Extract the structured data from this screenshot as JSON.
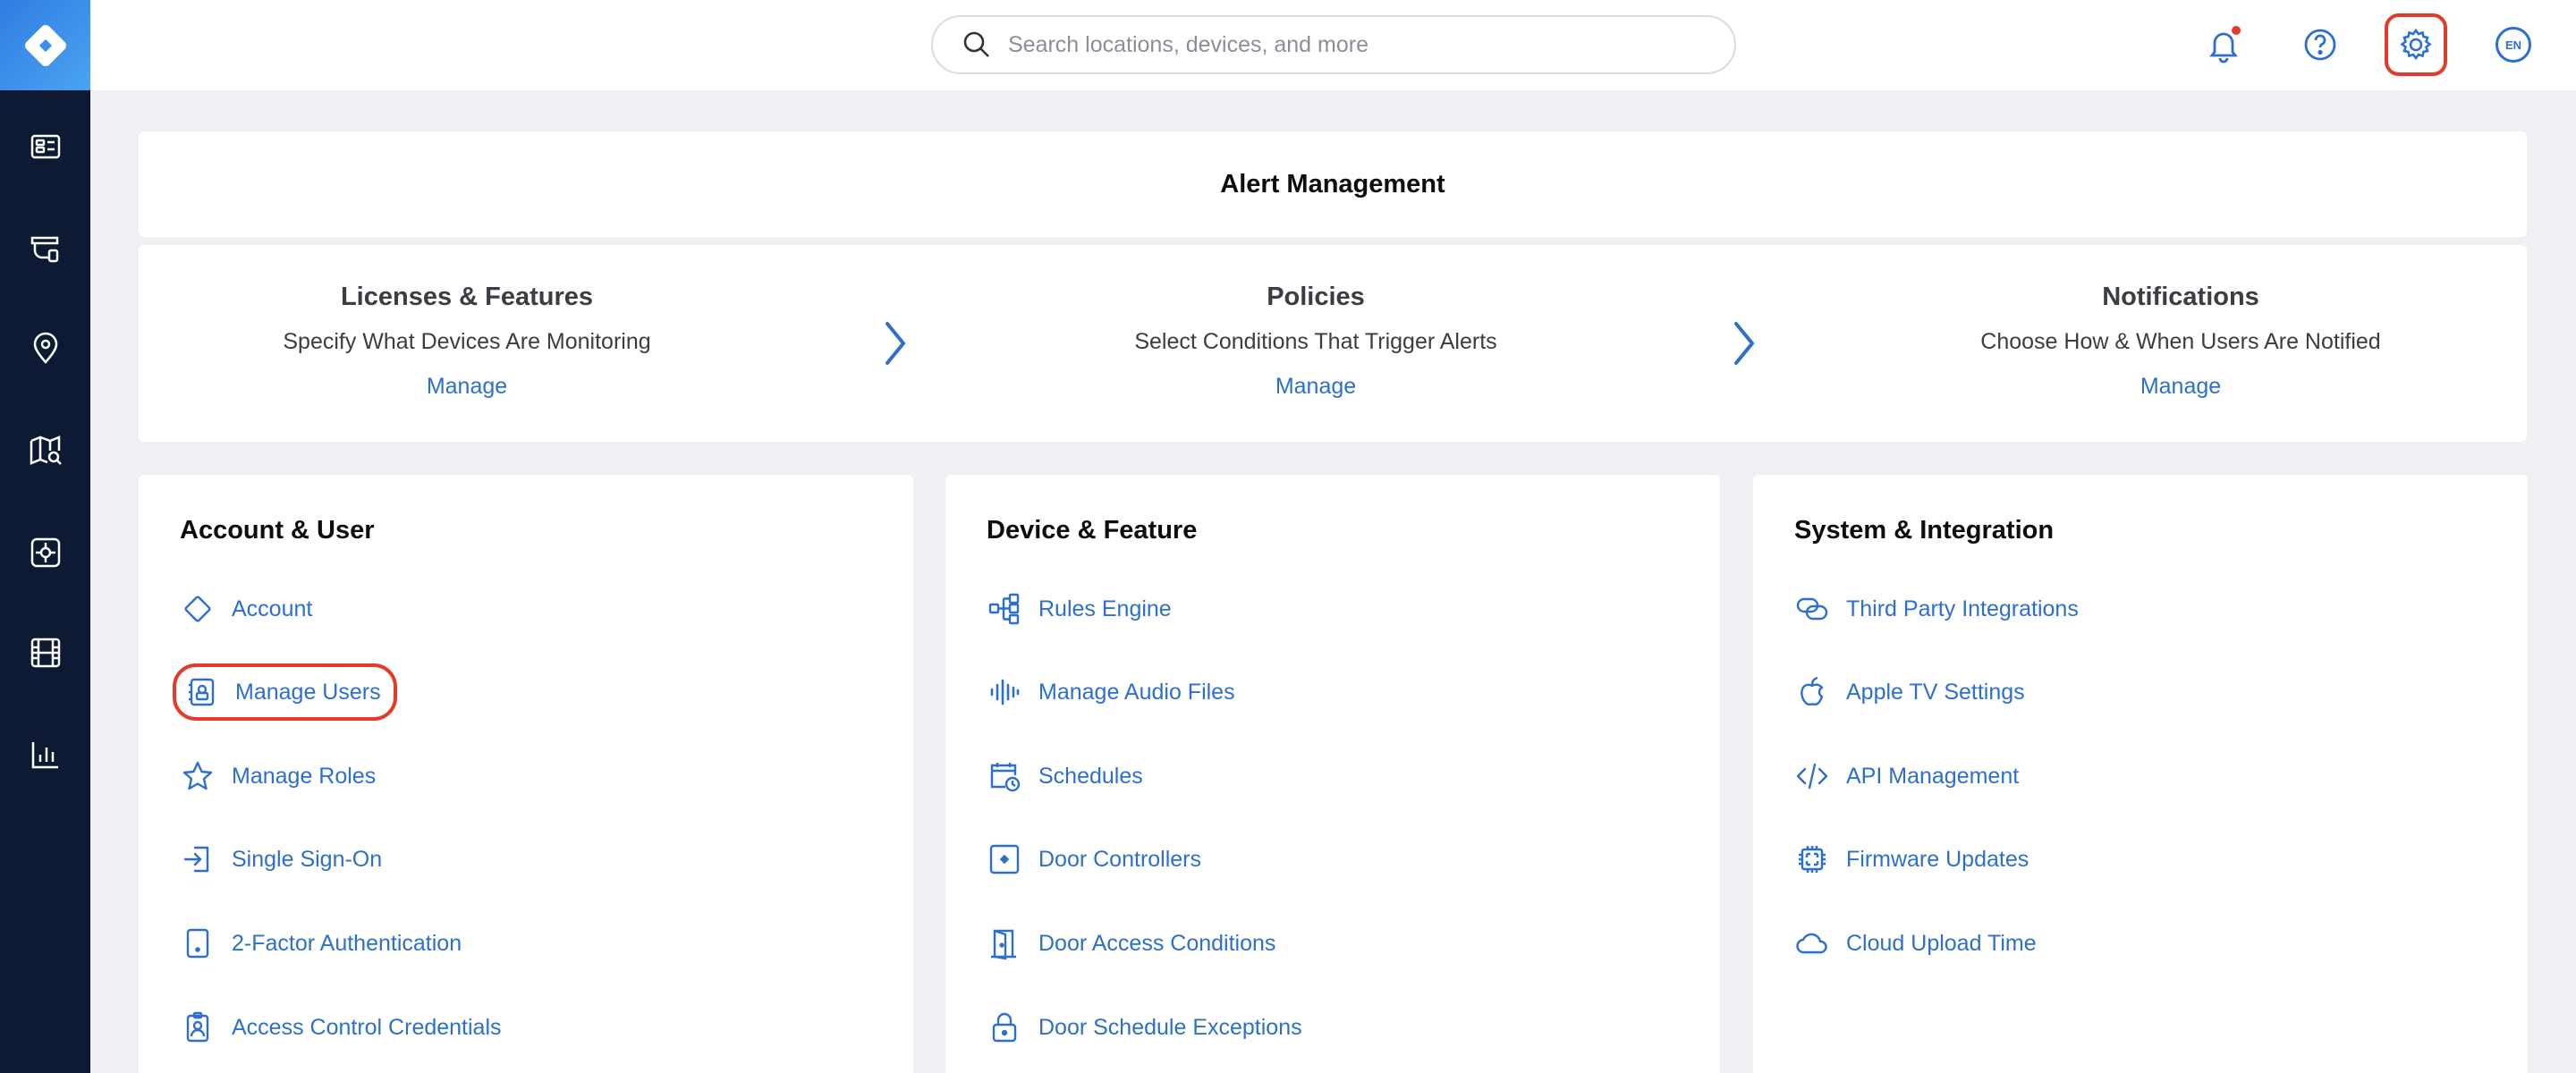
{
  "search": {
    "placeholder": "Search locations, devices, and more"
  },
  "header": {
    "language": "EN"
  },
  "alert_management": {
    "title": "Alert Management",
    "steps": [
      {
        "title": "Licenses & Features",
        "description": "Specify What Devices Are Monitoring",
        "link": "Manage"
      },
      {
        "title": "Policies",
        "description": "Select Conditions That Trigger Alerts",
        "link": "Manage"
      },
      {
        "title": "Notifications",
        "description": "Choose How & When Users Are Notified",
        "link": "Manage"
      }
    ]
  },
  "cards": [
    {
      "title": "Account & User",
      "items": [
        {
          "label": "Account",
          "icon": "diamond-icon"
        },
        {
          "label": "Manage Users",
          "icon": "user-badge-icon"
        },
        {
          "label": "Manage Roles",
          "icon": "star-icon"
        },
        {
          "label": "Single Sign-On",
          "icon": "sign-in-icon"
        },
        {
          "label": "2-Factor Authentication",
          "icon": "tablet-icon"
        },
        {
          "label": "Access Control Credentials",
          "icon": "id-badge-icon"
        }
      ]
    },
    {
      "title": "Device & Feature",
      "items": [
        {
          "label": "Rules Engine",
          "icon": "flow-icon"
        },
        {
          "label": "Manage Audio Files",
          "icon": "audio-wave-icon"
        },
        {
          "label": "Schedules",
          "icon": "calendar-clock-icon"
        },
        {
          "label": "Door Controllers",
          "icon": "door-controller-icon"
        },
        {
          "label": "Door Access Conditions",
          "icon": "door-icon"
        },
        {
          "label": "Door Schedule Exceptions",
          "icon": "lock-icon"
        }
      ]
    },
    {
      "title": "System & Integration",
      "items": [
        {
          "label": "Third Party Integrations",
          "icon": "link-icon"
        },
        {
          "label": "Apple TV Settings",
          "icon": "apple-icon"
        },
        {
          "label": "API Management",
          "icon": "code-icon"
        },
        {
          "label": "Firmware Updates",
          "icon": "chip-icon"
        },
        {
          "label": "Cloud Upload Time",
          "icon": "cloud-icon"
        }
      ]
    }
  ],
  "colors": {
    "accent": "#2c6fcf",
    "sidebar": "#0e1a33",
    "highlight": "#e23b2a",
    "background": "#eef0f3"
  }
}
